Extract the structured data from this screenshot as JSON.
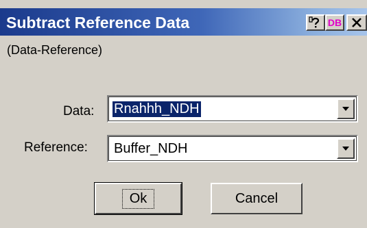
{
  "window": {
    "title": "Subtract Reference Data",
    "help_icon": "help-question-icon",
    "db_label": "DB",
    "close_icon": "close-icon"
  },
  "subtitle": "(Data-Reference)",
  "fields": {
    "data_label": "Data:",
    "data_value": "Rnahhh_NDH",
    "reference_label": "Reference:",
    "reference_value": "Buffer_NDH"
  },
  "buttons": {
    "ok_label": "Ok",
    "cancel_label": "Cancel"
  },
  "colors": {
    "titlebar_start": "#1b3a8c",
    "titlebar_end": "#a6c4ea",
    "selection": "#0a246a",
    "face": "#d4d0c8"
  }
}
